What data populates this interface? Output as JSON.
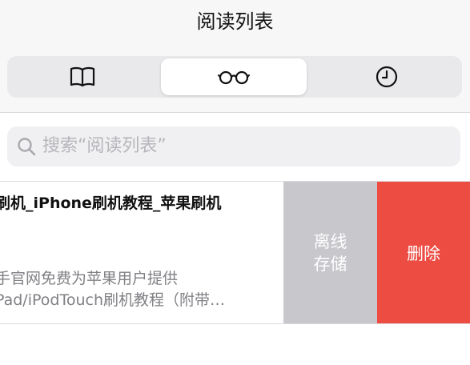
{
  "header": {
    "title": "阅读列表"
  },
  "segments": [
    {
      "icon": "book-icon",
      "selected": false
    },
    {
      "icon": "glasses-icon",
      "selected": true
    },
    {
      "icon": "clock-icon",
      "selected": false
    }
  ],
  "search": {
    "placeholder": "搜索“阅读列表”"
  },
  "reading_item": {
    "title": "刷机_iPhone刷机教程_苹果刷机",
    "desc_line1": "手官网免费为苹果用户提供",
    "desc_line2": "Pad/iPodTouch刷机教程（附带…"
  },
  "actions": {
    "offline_line1": "离线",
    "offline_line2": "存储",
    "delete": "删除"
  },
  "colors": {
    "delete": "#ec4c42",
    "offline": "#c7c7cc",
    "segment_bg": "#e9e9eb"
  }
}
